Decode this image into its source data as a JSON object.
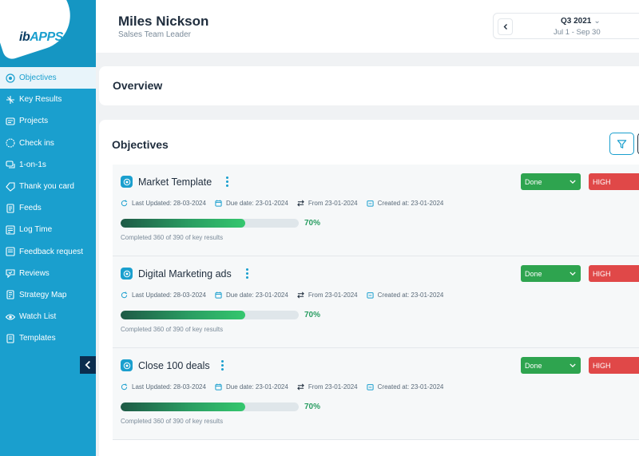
{
  "logo": {
    "text_i": "i",
    "text_b": "b",
    "text_apps": "APPS"
  },
  "colors": {
    "primary": "#1a9fce",
    "success": "#2ea44f",
    "danger": "#e04848",
    "dark": "#0b2d4e"
  },
  "sidebar": {
    "items": [
      {
        "label": "Objectives",
        "icon": "objectives-icon",
        "active": true
      },
      {
        "label": "Key Results",
        "icon": "key-results-icon"
      },
      {
        "label": "Projects",
        "icon": "projects-icon"
      },
      {
        "label": "Check ins",
        "icon": "check-ins-icon"
      },
      {
        "label": "1-on-1s",
        "icon": "one-on-one-icon"
      },
      {
        "label": "Thank you card",
        "icon": "thank-you-card-icon"
      },
      {
        "label": "Feeds",
        "icon": "feeds-icon"
      },
      {
        "label": "Log Time",
        "icon": "log-time-icon"
      },
      {
        "label": "Feedback request",
        "icon": "feedback-request-icon"
      },
      {
        "label": "Reviews",
        "icon": "reviews-icon"
      },
      {
        "label": "Strategy Map",
        "icon": "strategy-map-icon"
      },
      {
        "label": "Watch List",
        "icon": "watch-list-icon"
      },
      {
        "label": "Templates",
        "icon": "templates-icon"
      }
    ]
  },
  "header": {
    "name": "Miles Nickson",
    "role": "Salses Team Leader",
    "period": {
      "quarter": "Q3 2021",
      "range": "Jul 1 - Sep 30"
    }
  },
  "overview": {
    "title": "Overview"
  },
  "objectives": {
    "title": "Objectives",
    "items": [
      {
        "name": "Market Template",
        "status": "Done",
        "priority": "HIGH",
        "last_updated": "Last Updated: 28-03-2024",
        "due_date": "Due date: 23-01-2024",
        "from": "From 23-01-2024",
        "created_at": "Created at: 23-01-2024",
        "progress": 70,
        "progress_label": "70%",
        "completed_text": "Completed 360 of 390 of key results"
      },
      {
        "name": "Digital Marketing ads",
        "status": "Done",
        "priority": "HIGH",
        "last_updated": "Last Updated: 28-03-2024",
        "due_date": "Due date: 23-01-2024",
        "from": "From 23-01-2024",
        "created_at": "Created at: 23-01-2024",
        "progress": 70,
        "progress_label": "70%",
        "completed_text": "Completed 360 of 390 of key results"
      },
      {
        "name": "Close 100 deals",
        "status": "Done",
        "priority": "HIGH",
        "last_updated": "Last Updated: 28-03-2024",
        "due_date": "Due date: 23-01-2024",
        "from": "From 23-01-2024",
        "created_at": "Created at: 23-01-2024",
        "progress": 70,
        "progress_label": "70%",
        "completed_text": "Completed 360 of 390 of key results"
      }
    ]
  }
}
